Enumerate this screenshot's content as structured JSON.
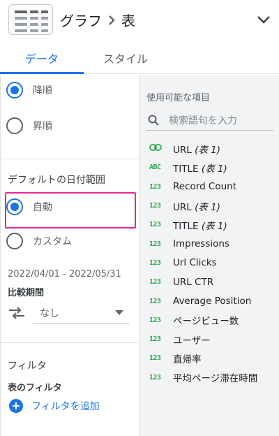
{
  "header": {
    "chart_name": "グラフ",
    "chart_type": "表",
    "thumbnail_icon": "table-chart-icon",
    "collapse_icon": "chevron-down-icon"
  },
  "tabs": [
    {
      "label": "データ",
      "active": true
    },
    {
      "label": "スタイル",
      "active": false
    }
  ],
  "sort": {
    "options": [
      {
        "label": "降順",
        "selected": true
      },
      {
        "label": "昇順",
        "selected": false
      }
    ]
  },
  "date_range": {
    "title": "デフォルトの日付範囲",
    "options": [
      {
        "label": "自動",
        "selected": true
      },
      {
        "label": "カスタム",
        "selected": false
      }
    ],
    "range_text": "2022/04/01 - 2022/05/31",
    "compare_label": "比較期間",
    "compare_value": "なし"
  },
  "filter": {
    "title": "フィルタ",
    "subtitle": "表のフィルタ",
    "add_label": "フィルタを追加"
  },
  "fields": {
    "title": "使用可能な項目",
    "search_placeholder": "検索語句を入力",
    "items": [
      {
        "type": "link",
        "name": "URL",
        "suffix": "(表 1)"
      },
      {
        "type": "ABC",
        "name": "TITLE",
        "suffix": "(表 1)"
      },
      {
        "type": "123",
        "name": "Record Count",
        "suffix": ""
      },
      {
        "type": "123",
        "name": "URL",
        "suffix": "(表 1)"
      },
      {
        "type": "123",
        "name": "TITLE",
        "suffix": "(表 1)"
      },
      {
        "type": "123",
        "name": "Impressions",
        "suffix": ""
      },
      {
        "type": "123",
        "name": "Url Clicks",
        "suffix": ""
      },
      {
        "type": "123",
        "name": "URL CTR",
        "suffix": ""
      },
      {
        "type": "123",
        "name": "Average Position",
        "suffix": ""
      },
      {
        "type": "123",
        "name": "ページビュー数",
        "suffix": ""
      },
      {
        "type": "123",
        "name": "ユーザー",
        "suffix": ""
      },
      {
        "type": "123",
        "name": "直帰率",
        "suffix": ""
      },
      {
        "type": "123",
        "name": "平均ページ滞在時間",
        "suffix": ""
      }
    ]
  },
  "colors": {
    "accent": "#1a73e8",
    "highlight": "#e8258f",
    "field_type": "#34a853"
  }
}
